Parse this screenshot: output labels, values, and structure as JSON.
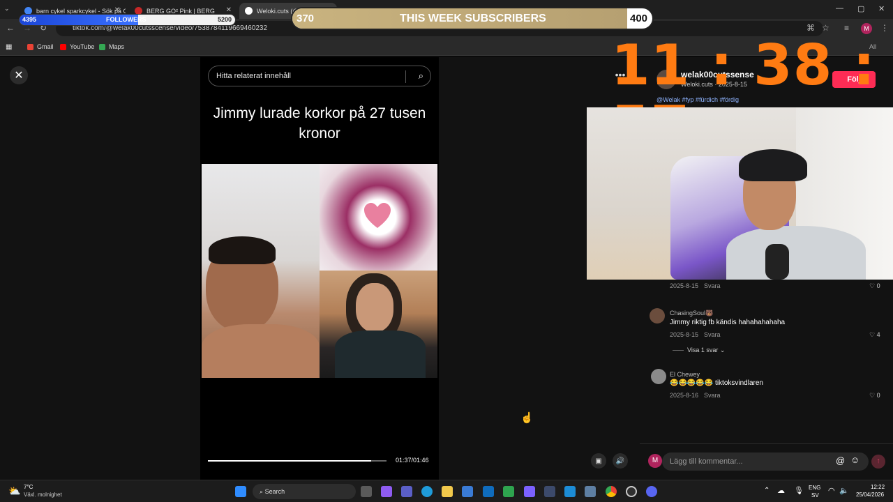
{
  "browser": {
    "tabs": [
      {
        "title": "barn cykel sparkcykel - Sök på G",
        "favicon_color": "#4285f4"
      },
      {
        "title": "BERG GO² Pink | BERG",
        "favicon_color": "#c62828"
      },
      {
        "title": "Weloki.cuts (@w",
        "favicon_color": "#ffffff"
      }
    ],
    "url": "tiktok.com/@welak00cutsscense/video/7538784119669460232",
    "bookmarks": [
      {
        "label": "Gmail",
        "color": "#ea4335"
      },
      {
        "label": "YouTube",
        "color": "#ff0000"
      },
      {
        "label": "Maps",
        "color": "#34a853"
      }
    ],
    "profile_initial": "M",
    "right_bookmark_fragment": "All"
  },
  "overlay": {
    "subs_title": "THIS WEEK SUBSCRIBERS",
    "subs_current": "370",
    "subs_goal": "400",
    "subs_fraction": 0.93,
    "followers_label": "FOLLOWERS",
    "followers_current": "4395",
    "followers_goal": "5200",
    "followers_fraction": 0.55,
    "timer": "11:38:57"
  },
  "video": {
    "search_placeholder": "Hitta relaterat innehåll",
    "caption": "Jimmy lurade korkor på 27 tusen kronor",
    "time": "01:37/01:46",
    "progress": 0.915
  },
  "post": {
    "author_handle": "welak00cutssense",
    "author_name": "Weloki.cuts",
    "date": "2025-8-15",
    "follow_label": "Följ",
    "hashtags": "@Welak #fyp #fürdich #fördig"
  },
  "comments": [
    {
      "name": "",
      "text": "",
      "date": "2025-8-15",
      "reply": "Svara",
      "likes": "0"
    },
    {
      "name": "ChasingSoul🐻",
      "text": "Jimmy riktig fb kändis hahahahahaha",
      "date": "2025-8-15",
      "reply": "Svara",
      "likes": "4",
      "view_replies": "Visa 1 svar"
    },
    {
      "name": "El Chewey",
      "text": "😂😂😂😂😂 tiktoksvindlaren",
      "date": "2025-8-16",
      "reply": "Svara",
      "likes": "0"
    }
  ],
  "comment_input": {
    "placeholder": "Lägg till kommentar...",
    "avatar_initial": "M"
  },
  "taskbar": {
    "weather_temp": "7°C",
    "weather_desc": "Växl. molnighet",
    "search_label": "Search",
    "lang": "ENG",
    "lang_sub": "SV",
    "time": "12:22",
    "date": "25/04/2026",
    "icons": [
      "windows-icon",
      "files-icon",
      "copilot-icon",
      "teams-icon",
      "edge-icon",
      "explorer-icon",
      "store-icon",
      "outlook-icon",
      "vpn-icon",
      "app-icon",
      "app2-icon",
      "photos-icon",
      "app3-icon",
      "chrome-icon",
      "obs-icon",
      "discord-icon"
    ]
  }
}
